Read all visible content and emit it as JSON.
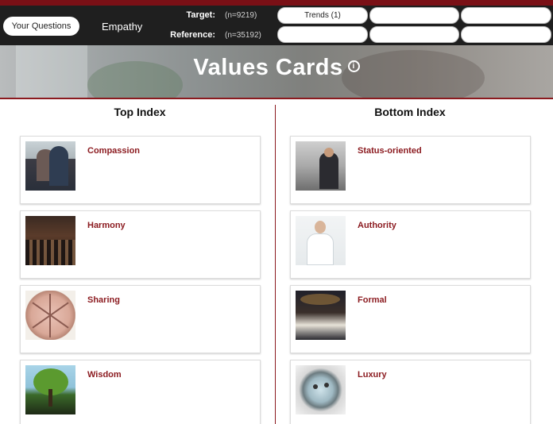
{
  "topbar": {
    "your_questions_label": "Your Questions",
    "empathy_label": "Empathy",
    "target_label": "Target:",
    "target_count": "(n=9219)",
    "reference_label": "Reference:",
    "reference_count": "(n=35192)",
    "slots": {
      "trends_label": "Trends (1)"
    }
  },
  "hero": {
    "title": "Values Cards",
    "info_glyph": "i"
  },
  "top_index": {
    "title": "Top Index",
    "cards": [
      {
        "label": "Compassion"
      },
      {
        "label": "Harmony"
      },
      {
        "label": "Sharing"
      },
      {
        "label": "Wisdom"
      }
    ]
  },
  "bottom_index": {
    "title": "Bottom Index",
    "cards": [
      {
        "label": "Status-oriented"
      },
      {
        "label": "Authority"
      },
      {
        "label": "Formal"
      },
      {
        "label": "Luxury"
      }
    ]
  },
  "colors": {
    "brand_red": "#8b1a1f",
    "topbar_bg": "#1f1f1f"
  }
}
